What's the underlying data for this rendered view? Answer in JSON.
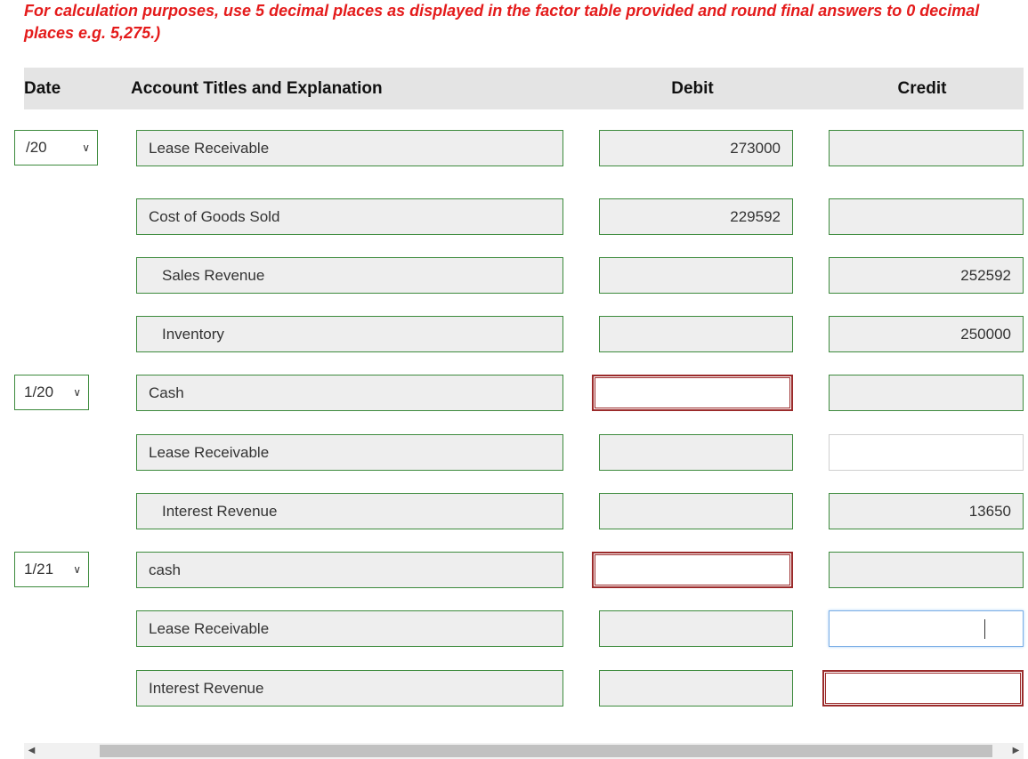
{
  "instructions": "For calculation purposes, use 5 decimal places as displayed in the factor table provided and round final answers to 0 decimal places e.g. 5,275.)",
  "table": {
    "headers": {
      "date": "Date",
      "account": "Account Titles and Explanation",
      "debit": "Debit",
      "credit": "Credit"
    },
    "rows": [
      {
        "date": "/20",
        "account": "Lease Receivable",
        "debit": "273000",
        "credit": ""
      },
      {
        "date": "",
        "account": "Cost of Goods Sold",
        "debit": "229592",
        "credit": ""
      },
      {
        "date": "",
        "account": "Sales Revenue",
        "debit": "",
        "credit": "252592"
      },
      {
        "date": "",
        "account": "Inventory",
        "debit": "",
        "credit": "250000"
      },
      {
        "date": "1/20",
        "account": "Cash",
        "debit": "",
        "credit": ""
      },
      {
        "date": "",
        "account": "Lease Receivable",
        "debit": "",
        "credit": ""
      },
      {
        "date": "",
        "account": "Interest Revenue",
        "debit": "",
        "credit": "13650"
      },
      {
        "date": "1/21",
        "account": "cash",
        "debit": "",
        "credit": ""
      },
      {
        "date": "",
        "account": "Lease Receivable",
        "debit": "",
        "credit": ""
      },
      {
        "date": "",
        "account": "Interest Revenue",
        "debit": "",
        "credit": ""
      }
    ]
  },
  "icons": {
    "select_chevron": "chevron-down-icon",
    "scroll_left": "scroll-left-arrow-icon",
    "scroll_right": "scroll-right-arrow-icon"
  },
  "colors": {
    "instructions_text": "#e41b1b",
    "field_border": "#3c8a3c",
    "error_border": "#9b2b2b",
    "header_background": "#e4e4e4"
  }
}
